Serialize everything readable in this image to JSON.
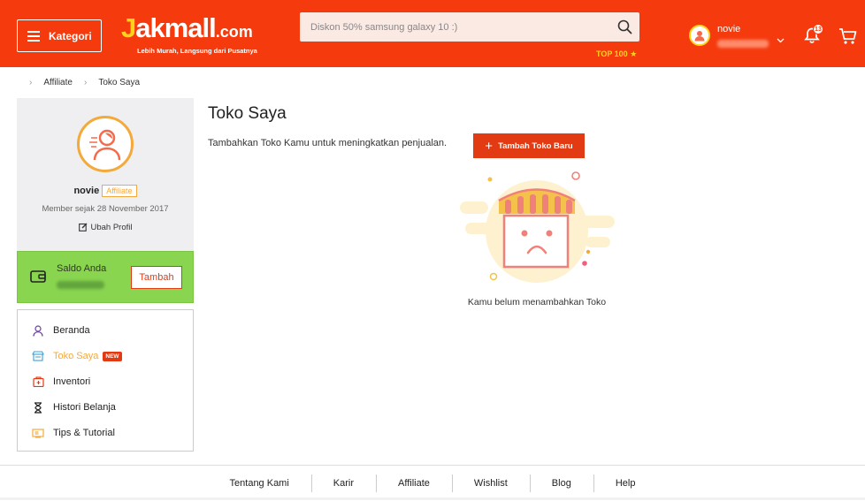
{
  "header": {
    "kategori_label": "Kategori",
    "logo_text": "akmall",
    "logo_j": "J",
    "logo_domain": ".com",
    "logo_tagline": "Lebih Murah, Langsung dari Pusatnya",
    "search_placeholder": "Diskon 50% samsung galaxy 10 :)",
    "top100_label": "TOP 100",
    "user_name": "novie",
    "notification_count": "13"
  },
  "breadcrumb": {
    "items": [
      "Affiliate",
      "Toko Saya"
    ]
  },
  "profile": {
    "name": "novie",
    "badge": "Affiliate",
    "member_since": "Member sejak 28 November 2017",
    "edit_label": "Ubah Profil"
  },
  "saldo": {
    "label": "Saldo Anda",
    "button_label": "Tambah"
  },
  "menu": {
    "items": [
      {
        "label": "Beranda",
        "icon": "user-icon"
      },
      {
        "label": "Toko Saya",
        "icon": "store-icon",
        "badge": "NEW",
        "active": true
      },
      {
        "label": "Inventori",
        "icon": "inventory-icon"
      },
      {
        "label": "Histori Belanja",
        "icon": "hourglass-icon"
      },
      {
        "label": "Tips & Tutorial",
        "icon": "tutorial-icon"
      }
    ]
  },
  "main": {
    "title": "Toko Saya",
    "subtitle": "Tambahkan Toko Kamu untuk meningkatkan penjualan.",
    "add_button_label": "Tambah Toko Baru",
    "empty_message": "Kamu belum menambahkan Toko"
  },
  "footer": {
    "links": [
      "Tentang Kami",
      "Karir",
      "Affiliate",
      "Wishlist",
      "Blog",
      "Help"
    ]
  },
  "colors": {
    "brand": "#f53b0e",
    "accent": "#f4a93b",
    "saldo_bg": "#89d54f",
    "button_red": "#e23a12"
  }
}
